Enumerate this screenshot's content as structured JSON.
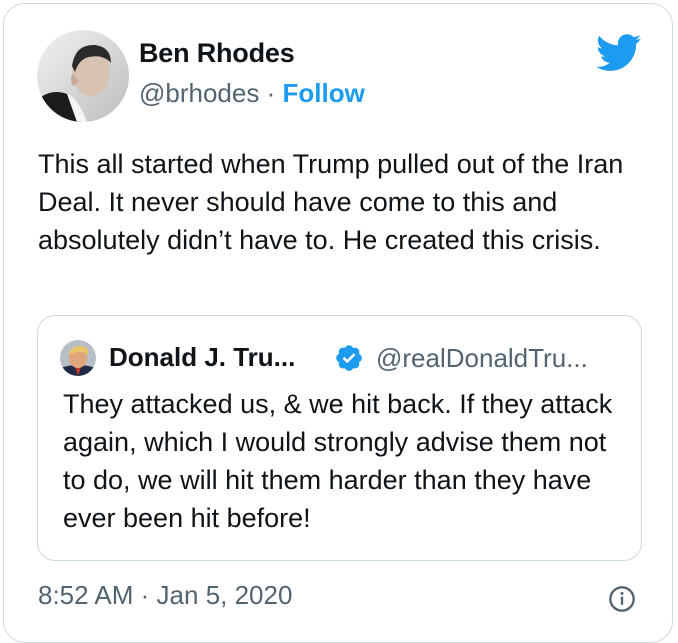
{
  "tweet": {
    "author": {
      "name": "Ben Rhodes",
      "handle": "@brhodes",
      "separator": "·",
      "follow_label": "Follow"
    },
    "text": "This all started when Trump pulled out of the Iran Deal. It never should have come to this and absolutely didn’t have to. He created this crisis.",
    "time": "8:52 AM",
    "date_separator": "·",
    "date": "Jan 5, 2020"
  },
  "quoted_tweet": {
    "author_name": "Donald J. Tru...",
    "author_handle": "@realDonaldTru...",
    "verified": true,
    "text": "They attacked us, & we hit back. If they attack again, which I would strongly advise them not to do, we will hit them harder than they have ever been hit before!"
  },
  "icons": {
    "brand": "twitter-bird-icon",
    "verified": "verified-badge-icon",
    "info": "info-icon"
  },
  "colors": {
    "accent": "#1d9bf0",
    "text_primary": "#0f1419",
    "text_secondary": "#536471",
    "border": "#cfd9de"
  }
}
